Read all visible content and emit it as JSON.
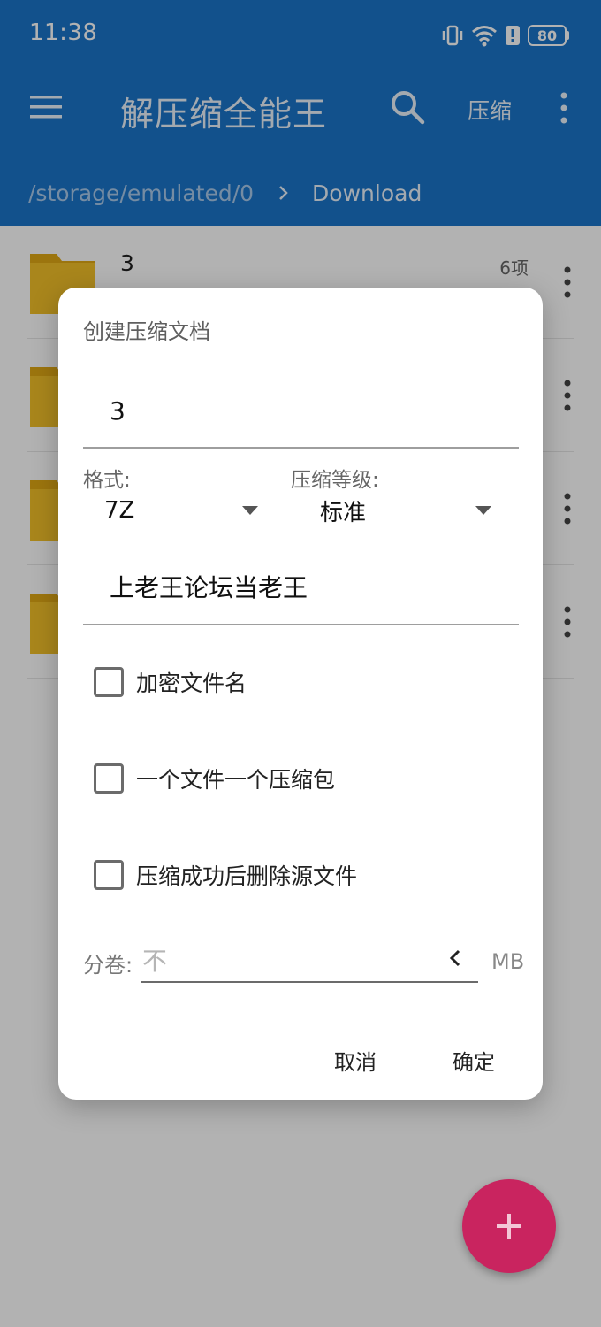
{
  "status_bar": {
    "time": "11:38",
    "battery": "80"
  },
  "toolbar": {
    "title": "解压缩全能王",
    "compress_label": "压缩"
  },
  "breadcrumb": {
    "root": "/storage/emulated/0",
    "current": "Download"
  },
  "file_list": [
    {
      "name": "3",
      "count": "6项"
    },
    {
      "name": "",
      "count": ""
    },
    {
      "name": "",
      "count": ""
    },
    {
      "name": "",
      "count": ""
    }
  ],
  "dialog": {
    "title": "创建压缩文档",
    "filename_value": "3",
    "format_label": "格式:",
    "format_value": "7Z",
    "level_label": "压缩等级:",
    "level_value": "标准",
    "password_value": "上老王论坛当老王",
    "options": [
      {
        "label": "加密文件名",
        "checked": false
      },
      {
        "label": "一个文件一个压缩包",
        "checked": false
      },
      {
        "label": "压缩成功后删除源文件",
        "checked": false
      }
    ],
    "split_label": "分卷:",
    "split_placeholder": "不",
    "split_unit": "MB",
    "cancel_label": "取消",
    "ok_label": "确定"
  },
  "colors": {
    "appbar": "#1a74c9",
    "fab": "#c9245f",
    "folder": "#f2c029"
  },
  "icons": {
    "menu": "menu-icon",
    "search": "search-icon",
    "more": "more-vert-icon",
    "add": "add-icon"
  }
}
